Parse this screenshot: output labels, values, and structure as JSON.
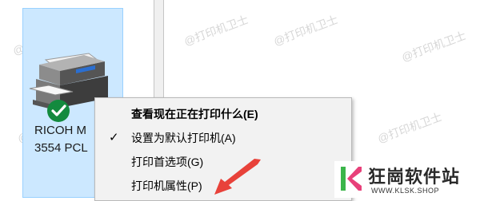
{
  "printer": {
    "name_line1": "RICOH M",
    "name_line2": "3554 PCL",
    "icon": "printer-icon",
    "status_icon": "default-check-icon"
  },
  "watermarks": [
    "@打印机卫士",
    "@打印机卫士",
    "@打印机卫士",
    "@打印机卫士",
    "@打印机卫士",
    "@打印机卫士"
  ],
  "context_menu": {
    "items": [
      {
        "label": "查看现在正在打印什么(E)",
        "bold": true,
        "checked": false
      },
      {
        "label": "设置为默认打印机(A)",
        "bold": false,
        "checked": true
      },
      {
        "label": "打印首选项(G)",
        "bold": false,
        "checked": false
      },
      {
        "label": "打印机属性(P)",
        "bold": false,
        "checked": false
      }
    ]
  },
  "annotation": {
    "arrow_color": "#e8423a"
  },
  "logo": {
    "name": "狂崗软件站",
    "url": "WWW.KLSK.SHOP",
    "colors": {
      "k_green": "#3bb54a",
      "k_pink": "#e8407a"
    }
  },
  "colors": {
    "selection_bg": "#cce8ff",
    "selection_border": "#99d1ff",
    "menu_bg": "#f2f2f2"
  }
}
